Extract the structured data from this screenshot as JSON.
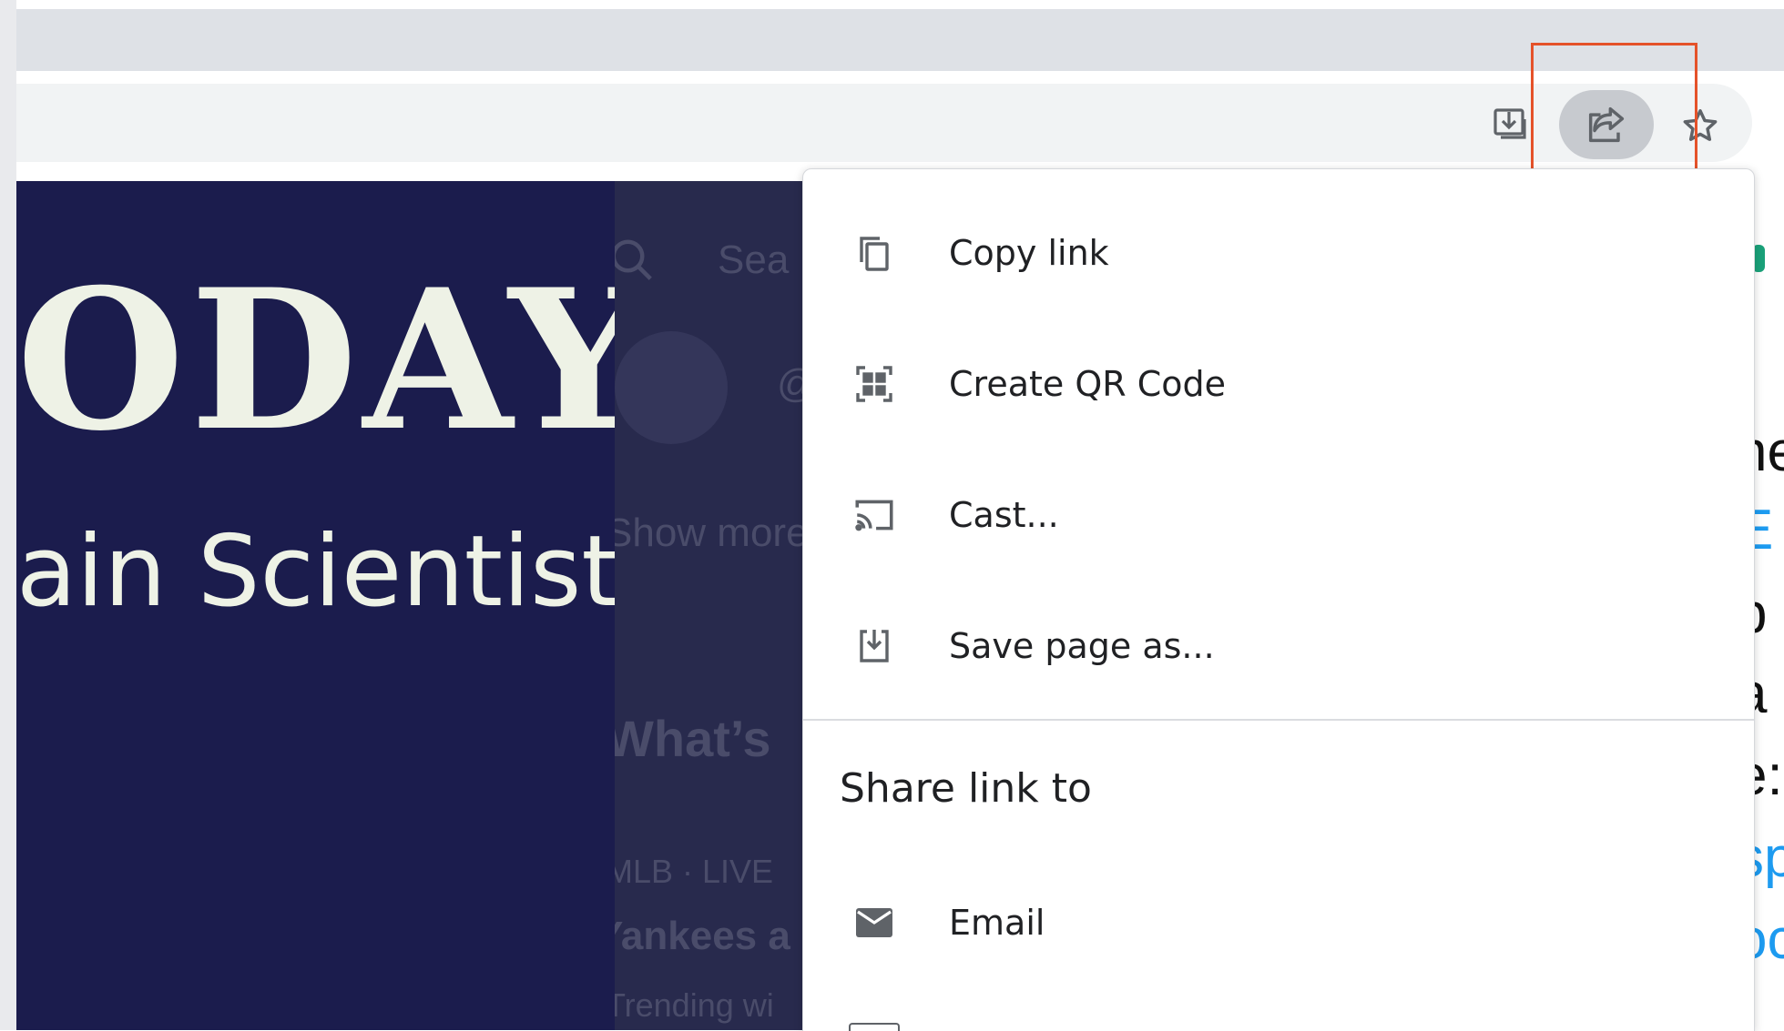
{
  "browser": {
    "toolbar_icons": [
      "download-icon",
      "share-icon",
      "star-icon"
    ]
  },
  "page": {
    "hero_title": "ODAY",
    "hero_subtitle": "ain Scientist",
    "search_placeholder": "Sea",
    "handle": "@",
    "show_more": "Show more",
    "whats": "What’s",
    "trend_meta": "MLB · LIVE",
    "trend_title": "Yankees a",
    "trend_sub": "Trending wi",
    "right_text": [
      "ne",
      "E",
      "p",
      "a",
      "e:",
      "sp",
      "oc"
    ]
  },
  "menu": {
    "items": [
      {
        "label": "Copy link",
        "icon": "copy-icon"
      },
      {
        "label": "Create QR Code",
        "icon": "qr-code-icon"
      },
      {
        "label": "Cast...",
        "icon": "cast-icon"
      },
      {
        "label": "Save page as...",
        "icon": "save-page-icon"
      }
    ],
    "section_title": "Share link to",
    "share_items": [
      {
        "label": "Email",
        "icon": "email-icon"
      }
    ]
  },
  "colors": {
    "highlight": "#e5522a",
    "hero_bg": "#1b1c4d",
    "link_blue": "#1d9bf0"
  }
}
